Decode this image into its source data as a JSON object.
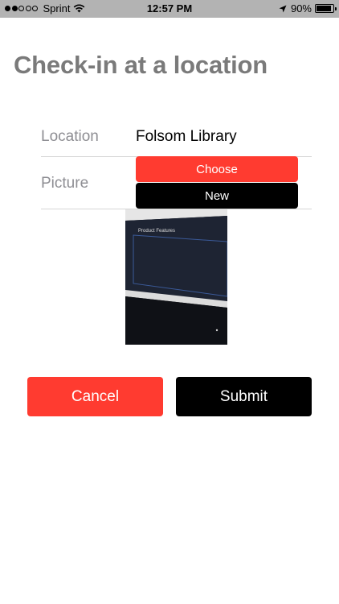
{
  "status_bar": {
    "carrier": "Sprint",
    "time": "12:57 PM",
    "battery_pct": "90%",
    "battery_level": 0.9,
    "signal_bars_filled": 2,
    "signal_bars_total": 5,
    "icons": [
      "signal-dots-icon",
      "wifi-icon",
      "location-arrow-icon",
      "battery-icon"
    ]
  },
  "page": {
    "title": "Check-in at a location"
  },
  "form": {
    "location_label": "Location",
    "location_value": "Folsom Library",
    "picture_label": "Picture",
    "choose_label": "Choose",
    "new_label": "New"
  },
  "photo": {
    "caption_text": "Product Features"
  },
  "actions": {
    "cancel_label": "Cancel",
    "submit_label": "Submit"
  },
  "colors": {
    "accent_red": "#ff3b30",
    "black": "#000000",
    "title_gray": "#7a7a7a",
    "label_gray": "#8e8e93"
  }
}
